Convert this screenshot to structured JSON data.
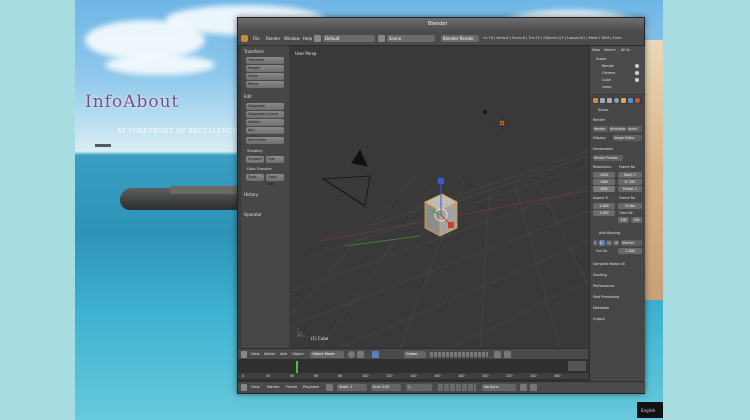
{
  "branding": {
    "logo_text": "InfoAbout",
    "logo_tagline": "AT FOREFRONT OF EXCELLENCE"
  },
  "window": {
    "title": "Blender"
  },
  "menubar": {
    "items": [
      "File",
      "Render",
      "Window",
      "Help"
    ],
    "layout": "Default",
    "scene": "Scene",
    "engine": "Blender Render",
    "stats": "v2.78 | Verts:8 | Faces:6 | Tris:12 | Objects:1/3 | Lamps:0/1 | Mem:7.65M | Cube"
  },
  "toolshelf": {
    "transform_header": "Transform",
    "transform_buttons": [
      "Translate",
      "Rotate",
      "Scale",
      "Mirror"
    ],
    "edit_header": "Edit",
    "edit_buttons": [
      "Duplicate",
      "Duplicate Linked",
      "Delete",
      "Join"
    ],
    "set_origin": "Set Origin",
    "shading_label": "Shading:",
    "shading_buttons": [
      "Smooth",
      "Flat"
    ],
    "data_transfer_label": "Data Transfer:",
    "data_transfer_buttons": [
      "Data",
      "Data Lay"
    ],
    "history_header": "History",
    "operator_header": "Operator"
  },
  "viewport": {
    "view_label": "User Persp",
    "object_label": "(1) Cube"
  },
  "outliner": {
    "items": [
      "View",
      "Search",
      "All Sc",
      "Scene",
      "Render",
      "Camera",
      "Cube",
      "Lamp"
    ]
  },
  "properties": {
    "scene_label": "Scene",
    "render_header": "Render",
    "render_buttons": [
      "Render",
      "Animation",
      "Audio"
    ],
    "display_label": "Display:",
    "display_value": "Image Editor",
    "dimensions_header": "Dimensions",
    "render_presets": "Render Presets",
    "resolution_label": "Resolution:",
    "frame_range_label": "Frame Ra",
    "res_x": "1920",
    "res_y": "1080",
    "res_pct": "50%",
    "start": "Start: 1",
    "end": "E: 250",
    "frame_step": "Frame: 1",
    "aspect_label": "Aspect R.",
    "frame_rate_label": "Frame Ra",
    "aspect_x": "1.000",
    "aspect_y": "1.000",
    "fps": "24 fps",
    "time_remapping_label": "Time Re",
    "time_old": "100",
    "time_new": "100",
    "aa_header": "Anti-Aliasing",
    "aa_samples": [
      "5",
      "8",
      "11",
      "16"
    ],
    "aa_filter": "Mitchell",
    "full_sample": "Full Sa",
    "filter_size": "1.000",
    "collapsed": [
      "Sampled Motion Bl",
      "Shading",
      "Performance",
      "Post Processing",
      "Metadata",
      "Output"
    ]
  },
  "viewport_header": {
    "items": [
      "View",
      "Select",
      "Add",
      "Object"
    ],
    "mode": "Object Mode",
    "pivot": "Global"
  },
  "timeline_header": {
    "items": [
      "View",
      "Marker",
      "Frame",
      "Playback"
    ],
    "start": "Start: 1",
    "end": "End: 250",
    "current": "1",
    "sync": "No Sync"
  },
  "timeline": {
    "ticks": [
      "0",
      "20",
      "40",
      "60",
      "80",
      "100",
      "120",
      "140",
      "160",
      "180",
      "200",
      "220",
      "240",
      "260"
    ]
  },
  "taskbar": {
    "label": "English"
  }
}
